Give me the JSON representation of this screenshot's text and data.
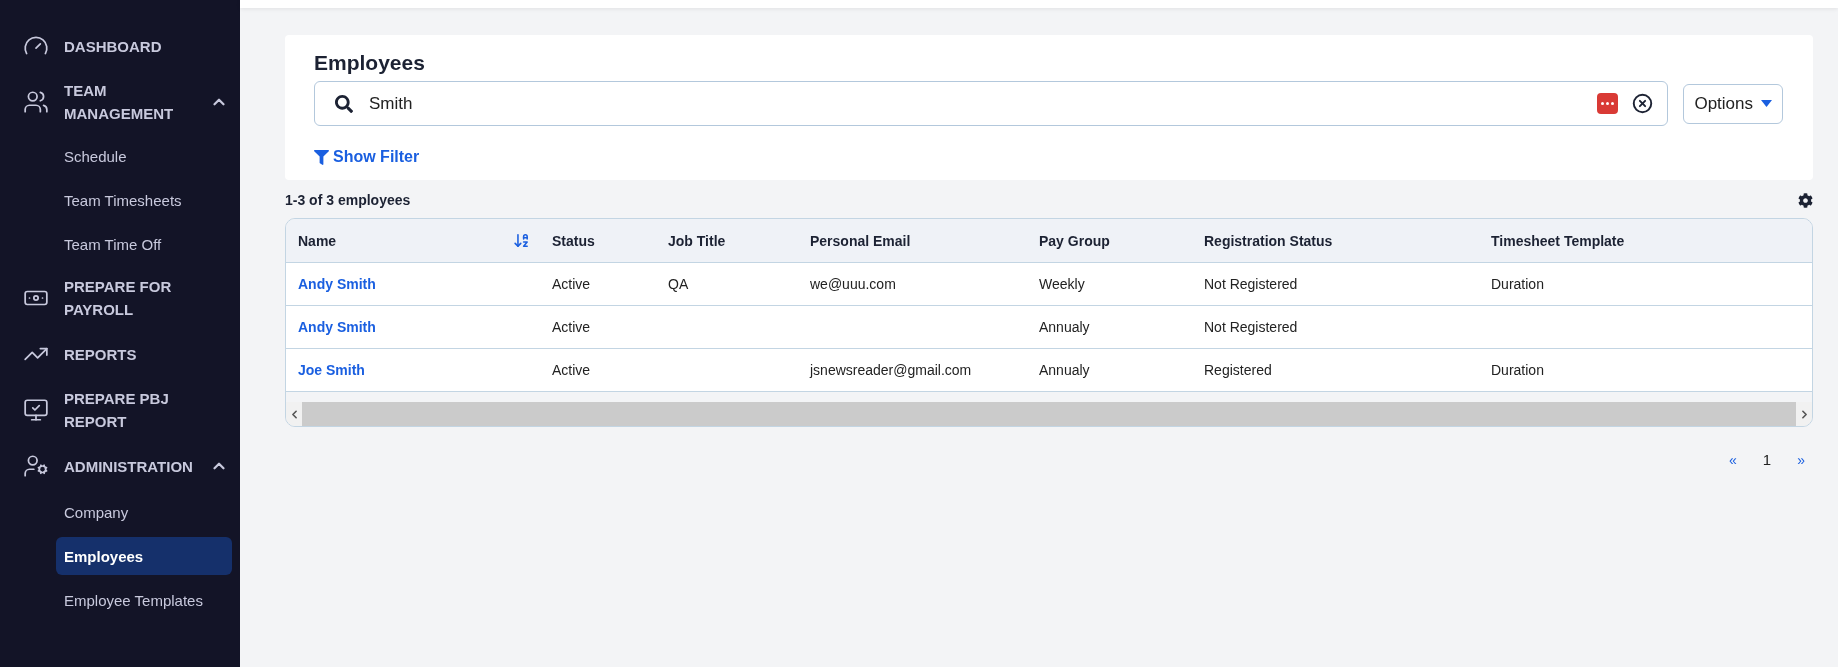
{
  "sidebar": {
    "items": [
      {
        "label": "DASHBOARD"
      },
      {
        "label": "TEAM MANAGEMENT",
        "expanded": true,
        "children": [
          {
            "label": "Schedule",
            "selected": false
          },
          {
            "label": "Team Timesheets",
            "selected": false
          },
          {
            "label": "Team Time Off",
            "selected": false
          }
        ]
      },
      {
        "label": "PREPARE FOR PAYROLL"
      },
      {
        "label": "REPORTS"
      },
      {
        "label": "PREPARE PBJ REPORT"
      },
      {
        "label": "ADMINISTRATION",
        "expanded": true,
        "children": [
          {
            "label": "Company",
            "selected": false
          },
          {
            "label": "Employees",
            "selected": true
          },
          {
            "label": "Employee Templates",
            "selected": false
          }
        ]
      }
    ]
  },
  "page": {
    "title": "Employees",
    "search": {
      "value": "Smith"
    },
    "options_button": "Options",
    "filter_link": "Show Filter"
  },
  "result_count": "1-3 of 3 employees",
  "table": {
    "columns": [
      {
        "label": "Name",
        "sorted": true
      },
      {
        "label": "Status",
        "sorted": false
      },
      {
        "label": "Job Title",
        "sorted": false
      },
      {
        "label": "Personal Email",
        "sorted": false
      },
      {
        "label": "Pay Group",
        "sorted": false
      },
      {
        "label": "Registration Status",
        "sorted": false
      },
      {
        "label": "Timesheet Template",
        "sorted": false
      }
    ],
    "rows": [
      [
        "Andy Smith",
        "Active",
        "QA",
        "we@uuu.com",
        "Weekly",
        "Not Registered",
        "Duration"
      ],
      [
        "Andy Smith",
        "Active",
        "",
        "",
        "Annualy",
        "Not Registered",
        ""
      ],
      [
        "Joe Smith",
        "Active",
        "",
        "jsnewsreader@gmail.com",
        "Annualy",
        "Registered",
        "Duration"
      ]
    ]
  },
  "pagination": {
    "previous": "«",
    "pages": [
      {
        "label": "1",
        "selected": true
      }
    ],
    "next": "»"
  }
}
